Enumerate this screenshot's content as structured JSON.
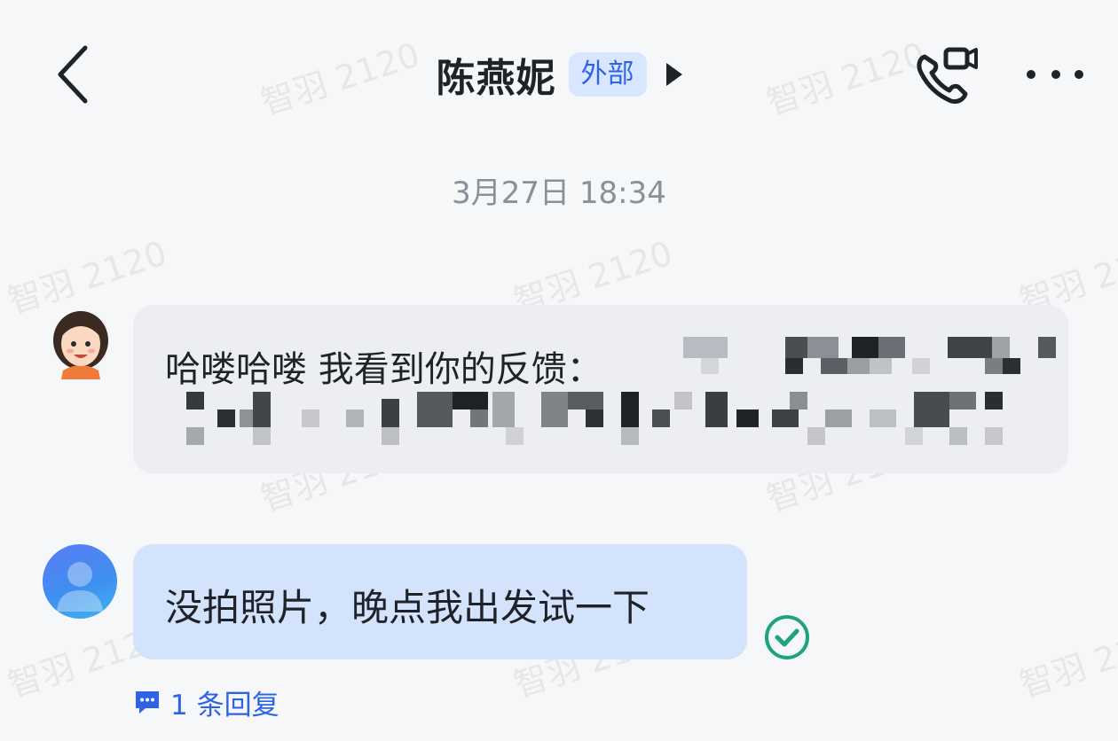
{
  "header": {
    "contact_name": "陈燕妮",
    "external_badge": "外部",
    "back_icon": "chevron-left-icon",
    "call_icon": "phone-video-icon",
    "more_icon": "ellipsis-icon"
  },
  "conversation": {
    "timestamp": "3月27日 18:34",
    "messages": [
      {
        "sender": "contact",
        "text": "哈喽哈喽 我看到你的反馈：",
        "redacted": true
      },
      {
        "sender": "self",
        "text": "没拍照片，晚点我出发试一下",
        "status_icon": "read-check-icon"
      }
    ],
    "reply_count_label": "1 条回复"
  },
  "watermark": {
    "text": "智羽 2120"
  },
  "colors": {
    "accent": "#2e63e6",
    "bubble_in": "#eceef1",
    "bubble_out": "#d3e3fb",
    "read_check": "#1ea37d",
    "background": "#f6f7f9"
  }
}
